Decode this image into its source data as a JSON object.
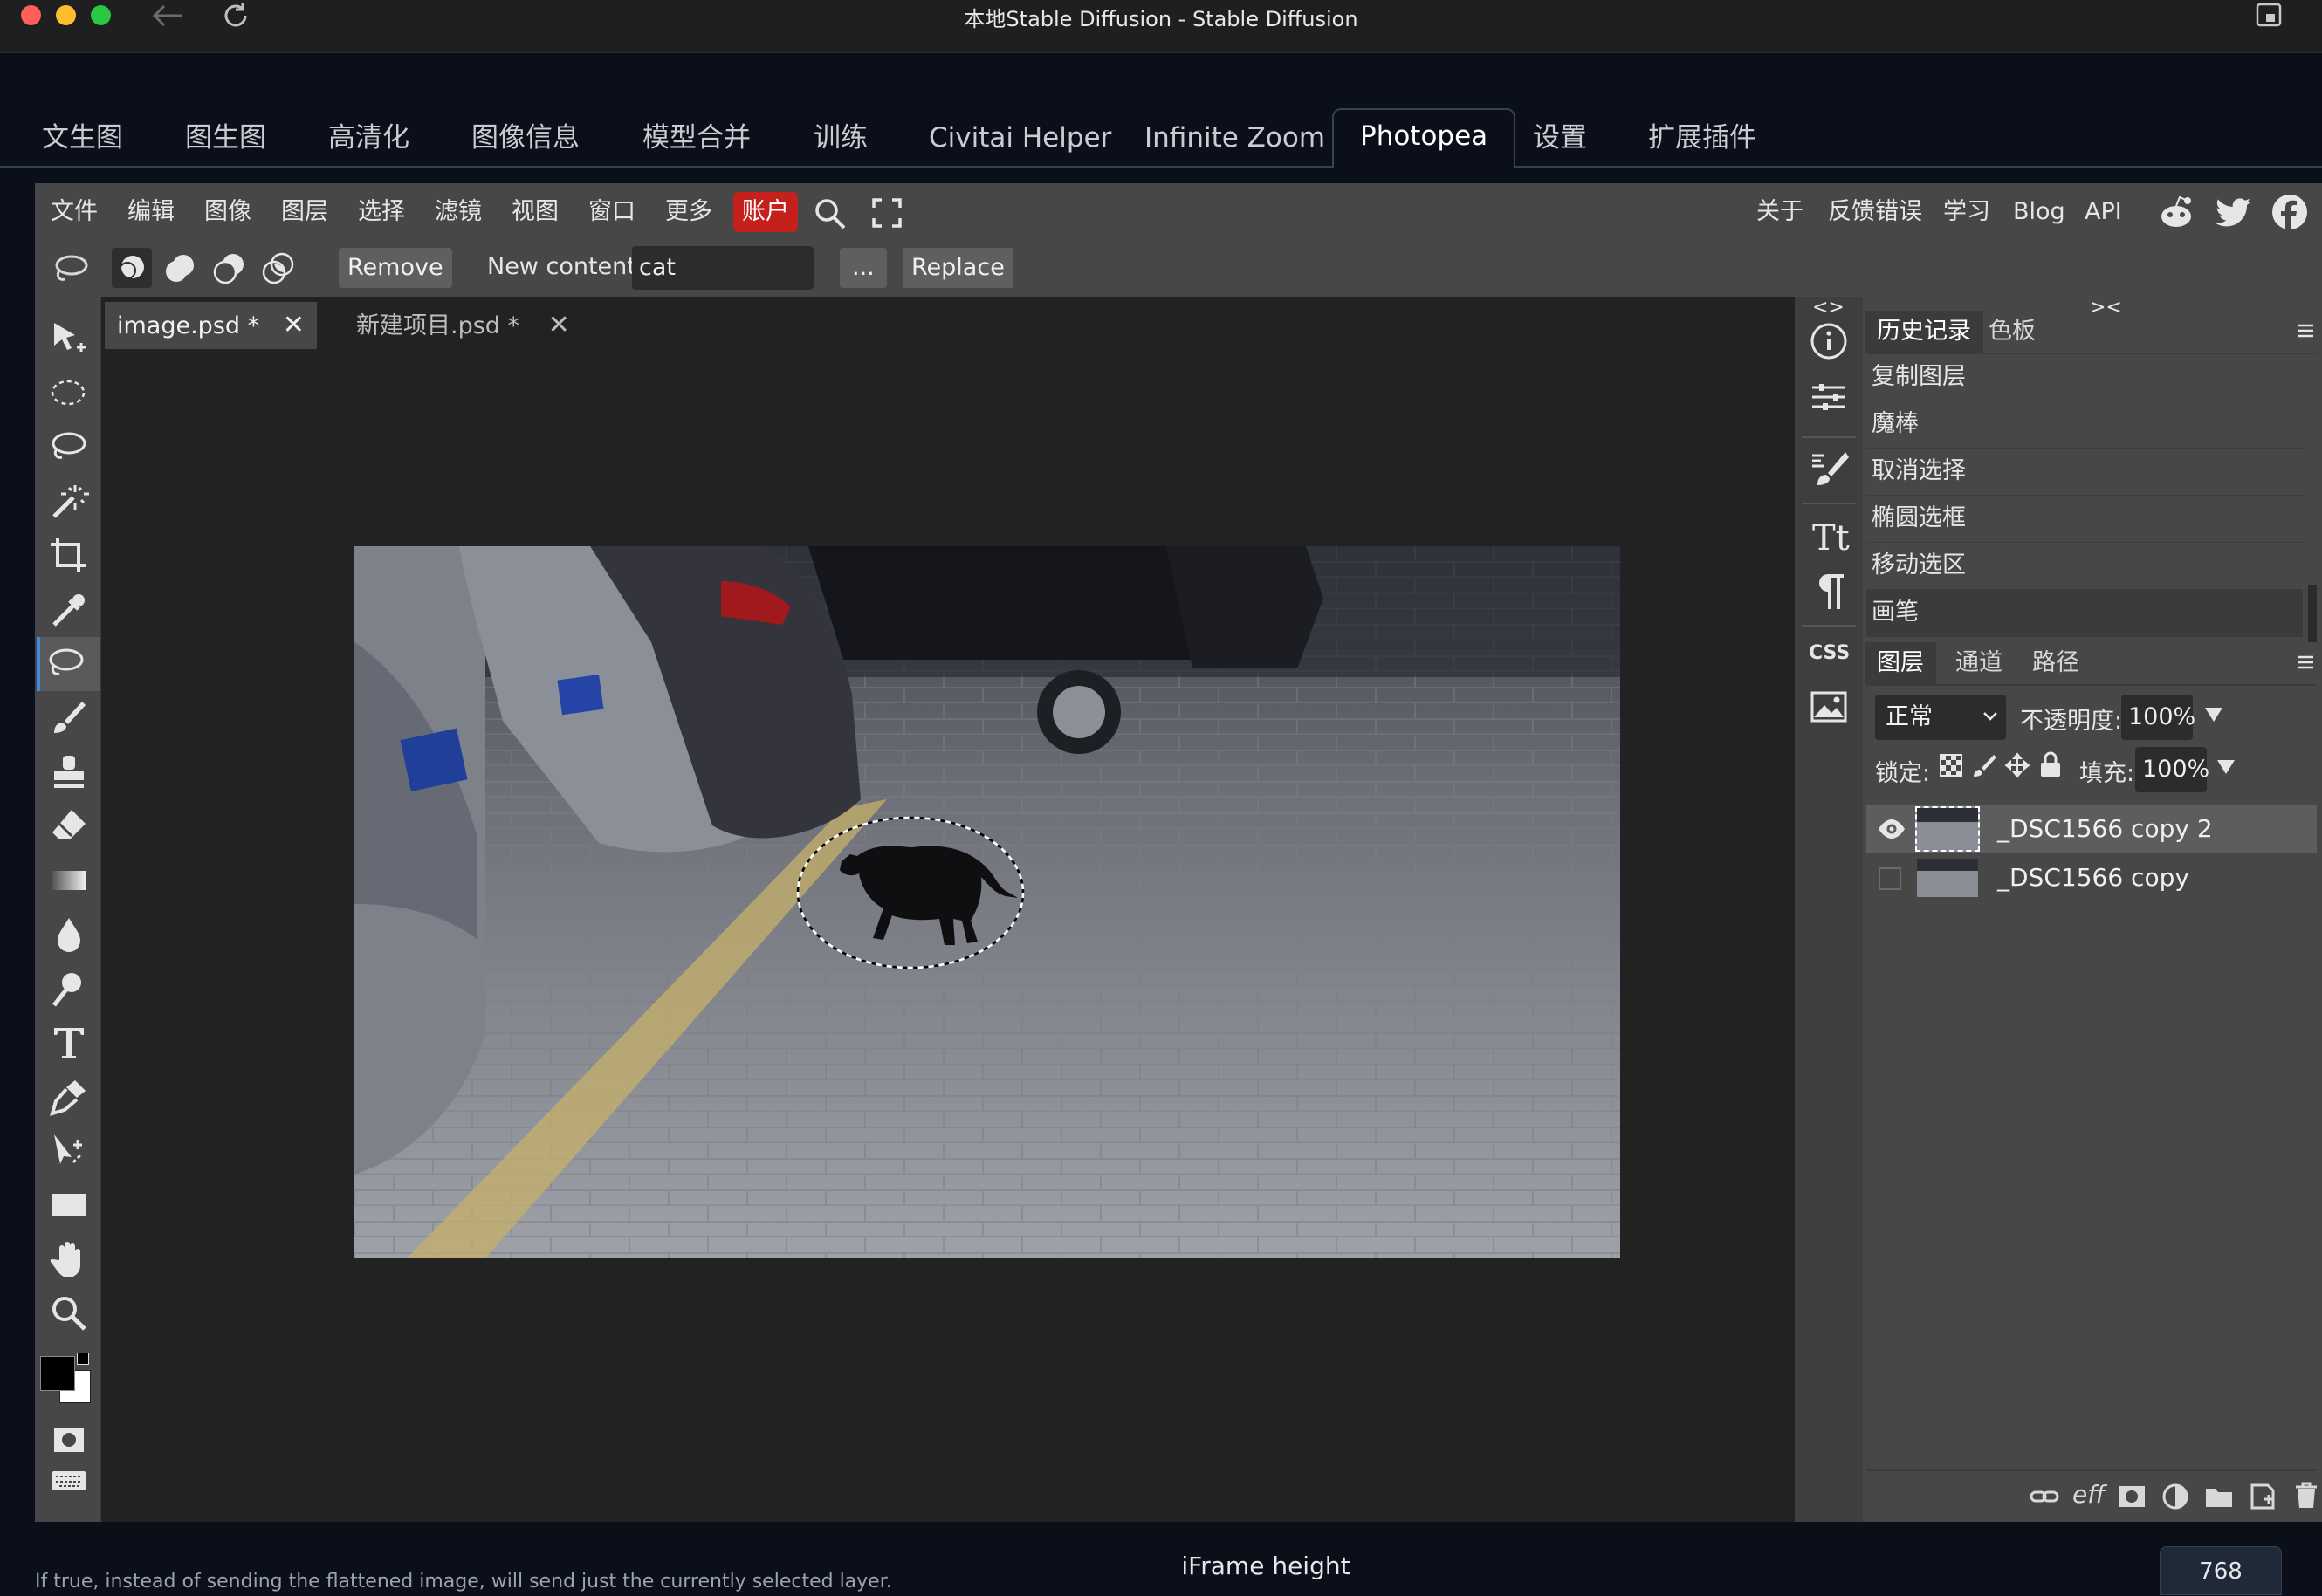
{
  "window": {
    "title": "本地Stable Diffusion - Stable Diffusion",
    "traffic_colors": [
      "#fe5f57",
      "#febc2e",
      "#28c840"
    ]
  },
  "webui_tabs": [
    {
      "label": "文生图",
      "active": false
    },
    {
      "label": "图生图",
      "active": false
    },
    {
      "label": "高清化",
      "active": false
    },
    {
      "label": "图像信息",
      "active": false
    },
    {
      "label": "模型合并",
      "active": false
    },
    {
      "label": "训练",
      "active": false
    },
    {
      "label": "Civitai Helper",
      "active": false
    },
    {
      "label": "Infinite Zoom",
      "active": false
    },
    {
      "label": "Photopea",
      "active": true
    },
    {
      "label": "设置",
      "active": false
    },
    {
      "label": "扩展插件",
      "active": false
    }
  ],
  "photopea": {
    "menu": [
      "文件",
      "编辑",
      "图像",
      "图层",
      "选择",
      "滤镜",
      "视图",
      "窗口",
      "更多"
    ],
    "account": "账户",
    "right_menu": [
      "关于",
      "反馈错误",
      "学习",
      "Blog",
      "API"
    ],
    "social_icons": [
      "reddit-icon",
      "twitter-icon",
      "facebook-icon"
    ],
    "options": {
      "remove_label": "Remove",
      "new_content_label": "New content:",
      "new_content_value": "cat",
      "more_label": "...",
      "replace_label": "Replace"
    },
    "tools": [
      "move-tool-icon",
      "marquee-tool-icon",
      "lasso-tool-icon",
      "magic-wand-icon",
      "crop-tool-icon",
      "eyedropper-icon",
      "object-select-icon",
      "brush-tool-icon",
      "stamp-tool-icon",
      "eraser-tool-icon",
      "gradient-tool-icon",
      "blur-tool-icon",
      "dodge-tool-icon",
      "type-tool-icon",
      "pen-tool-icon",
      "path-select-icon",
      "shape-tool-icon",
      "hand-tool-icon",
      "zoom-tool-icon"
    ],
    "doc_tabs": [
      {
        "label": "image.psd *",
        "active": true
      },
      {
        "label": "新建项目.psd *",
        "active": false
      }
    ],
    "history_tabs": [
      "历史记录",
      "色板"
    ],
    "history": [
      "复制图层",
      "魔棒",
      "取消选择",
      "椭圆选框",
      "移动选区",
      "画笔"
    ],
    "layers_tabs": [
      "图层",
      "通道",
      "路径"
    ],
    "blend_mode": "正常",
    "opacity_label": "不透明度:",
    "opacity_value": "100%",
    "lock_label": "锁定:",
    "fill_label": "填充:",
    "fill_value": "100%",
    "layers": [
      {
        "name": "_DSC1566 copy 2",
        "visible": true,
        "selected": true
      },
      {
        "name": "_DSC1566 copy",
        "visible": false,
        "selected": false
      }
    ],
    "panel_toggles": [
      "<>",
      "><"
    ],
    "strip_css_label": "CSS"
  },
  "footer": {
    "hint": "If true, instead of sending the flattened image, will send just the currently selected layer.",
    "iframe_label": "iFrame height",
    "iframe_value": "768"
  }
}
